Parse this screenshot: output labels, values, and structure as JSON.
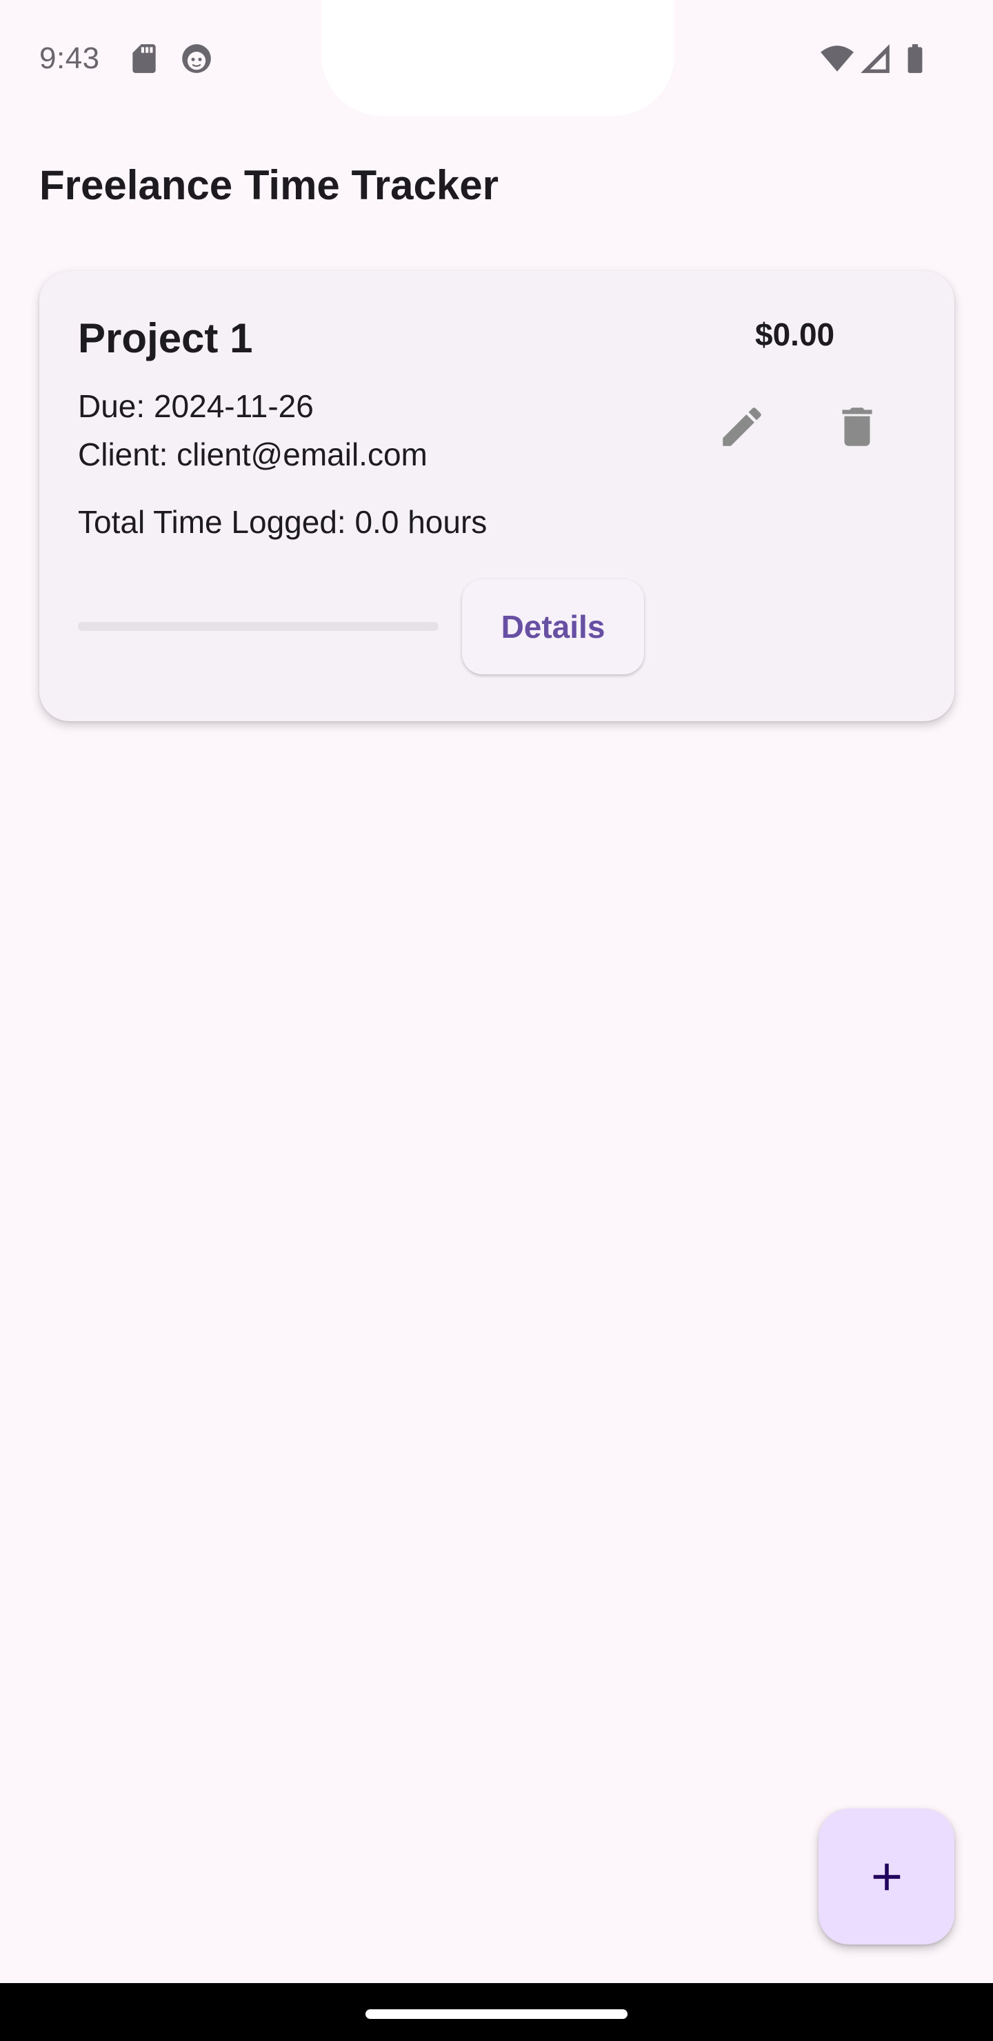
{
  "status_bar": {
    "time": "9:43",
    "icons": [
      "sd-card-icon",
      "android-debug-icon",
      "wifi-icon",
      "cell-signal-icon",
      "battery-icon"
    ]
  },
  "app_bar": {
    "title": "Freelance Time Tracker"
  },
  "projects": [
    {
      "name": "Project 1",
      "amount": "$0.00",
      "due": "Due: 2024-11-26",
      "client": "Client: client@email.com",
      "total_time": "Total Time Logged: 0.0 hours",
      "progress": 0,
      "details_label": "Details",
      "actions": [
        "pencil-icon",
        "trash-icon"
      ]
    }
  ],
  "fab": {
    "icon": "plus-icon"
  },
  "colors": {
    "background": "#fdf7fc",
    "card": "#f5f1f6",
    "primary": "#6750a4",
    "fab": "#eaddff",
    "icon_gray": "#8a8a8a",
    "text": "#1d1b20"
  }
}
